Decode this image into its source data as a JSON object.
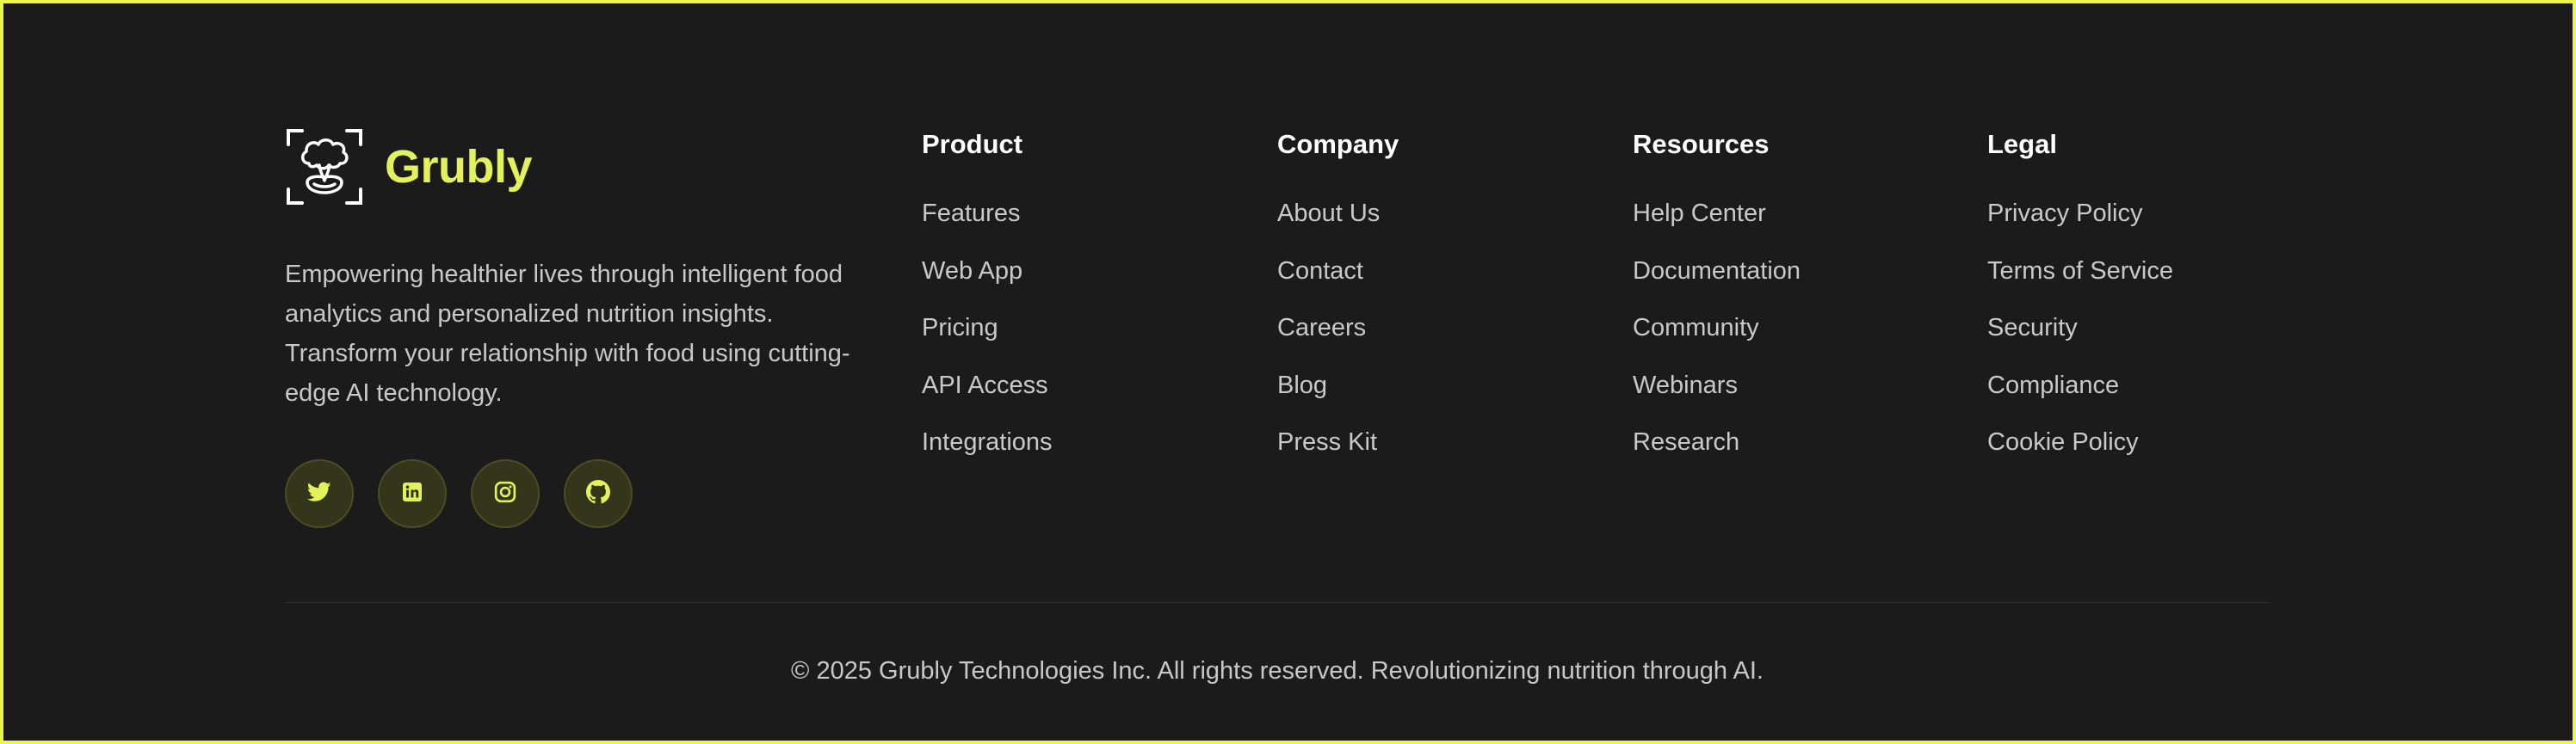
{
  "brand": {
    "name": "Grubly",
    "tagline": "Empowering healthier lives through intelligent food analytics and personalized nutrition insights. Transform your relationship with food using cutting-edge AI technology.",
    "logo_icon": "brain-scan-icon",
    "accent_color": "#e3f25a"
  },
  "socials": [
    {
      "icon": "twitter-icon"
    },
    {
      "icon": "linkedin-icon"
    },
    {
      "icon": "instagram-icon"
    },
    {
      "icon": "github-icon"
    }
  ],
  "columns": {
    "product": {
      "title": "Product",
      "links": [
        "Features",
        "Web App",
        "Pricing",
        "API Access",
        "Integrations"
      ]
    },
    "company": {
      "title": "Company",
      "links": [
        "About Us",
        "Contact",
        "Careers",
        "Blog",
        "Press Kit"
      ]
    },
    "resources": {
      "title": "Resources",
      "links": [
        "Help Center",
        "Documentation",
        "Community",
        "Webinars",
        "Research"
      ]
    },
    "legal": {
      "title": "Legal",
      "links": [
        "Privacy Policy",
        "Terms of Service",
        "Security",
        "Compliance",
        "Cookie Policy"
      ]
    }
  },
  "footer": {
    "copyright": "© 2025 Grubly Technologies Inc. All rights reserved. Revolutionizing nutrition through AI."
  }
}
